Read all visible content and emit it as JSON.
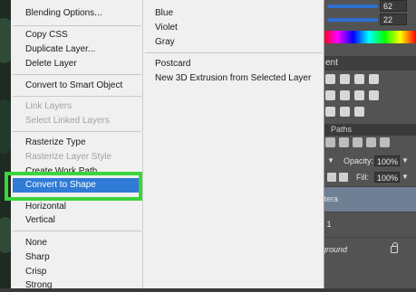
{
  "menu": {
    "items": [
      "Blending Options...",
      "Copy CSS",
      "Duplicate Layer...",
      "Delete Layer",
      "Convert to Smart Object",
      "Link Layers",
      "Select Linked Layers",
      "Rasterize Type",
      "Rasterize Layer Style",
      "Create Work Path",
      "Convert to Shape",
      "Horizontal",
      "Vertical",
      "None",
      "Sharp",
      "Crisp",
      "Strong"
    ],
    "selected": "Convert to Shape"
  },
  "submenu": {
    "items": [
      "Blue",
      "Violet",
      "Gray",
      "Postcard",
      "New 3D Extrusion from Selected Layer"
    ]
  },
  "panel": {
    "slider_values": [
      "62",
      "22"
    ],
    "adjust_tab": "ent",
    "paths_tab": "Paths",
    "opacity_label": "Opacity:",
    "opacity_value": "100%",
    "fill_label": "Fill:",
    "fill_value": "100%",
    "layers": [
      "ttera",
      "r 1",
      "ground"
    ]
  },
  "colors": {
    "highlight_green": "#3bd43b",
    "selection_blue": "#2f7bd6",
    "menu_bg": "#f0f0f0",
    "panel_bg": "#535353",
    "disabled_text": "#a2a2a2"
  }
}
